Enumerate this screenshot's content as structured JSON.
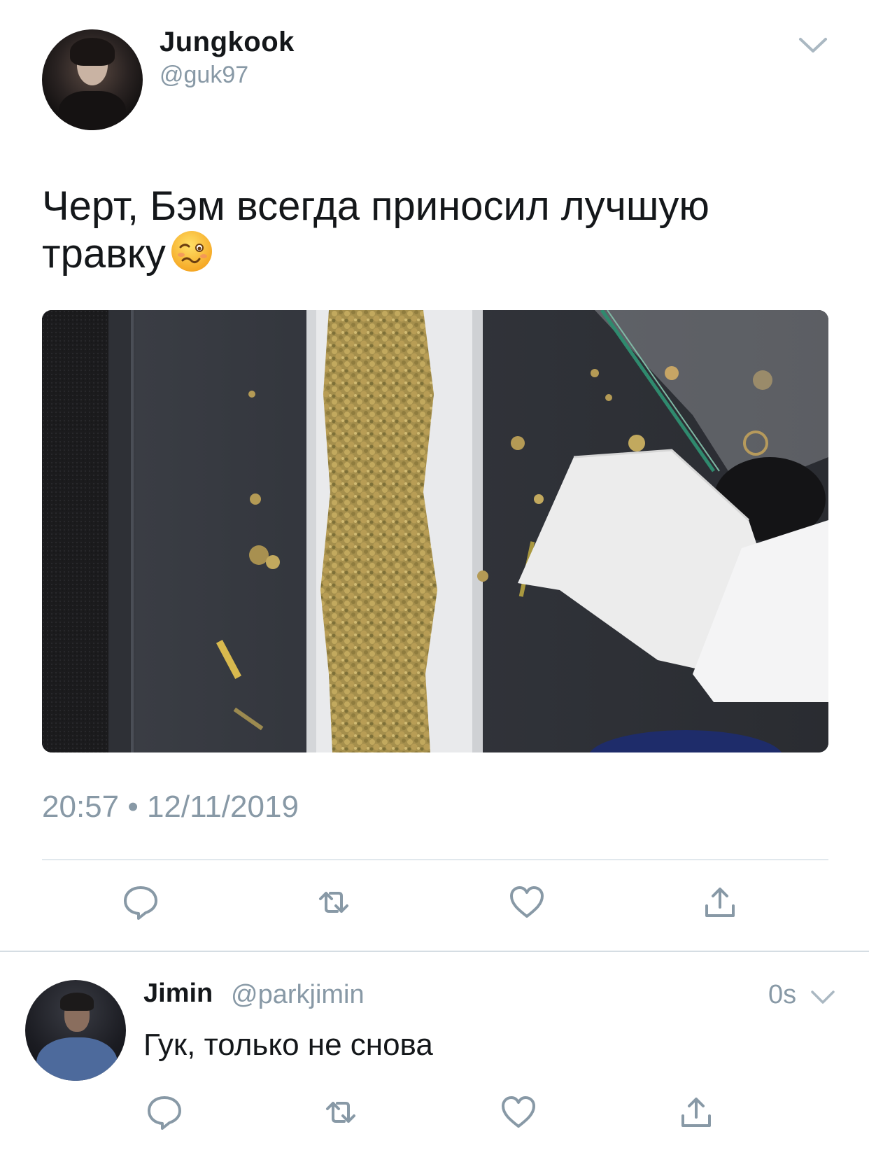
{
  "tweet": {
    "author_name": "Jungkook",
    "author_handle": "@guk97",
    "text": "Черт, Бэм всегда приносил лучшую травку",
    "emoji": "woozy-face",
    "timestamp": "20:57 • 12/11/2019",
    "actions": [
      "reply-icon",
      "retweet-icon",
      "like-icon",
      "share-icon"
    ]
  },
  "reply": {
    "author_name": "Jimin",
    "author_handle": "@parkjimin",
    "time": "0s",
    "text": "Гук, только не снова",
    "actions": [
      "reply-icon",
      "retweet-icon",
      "like-icon",
      "share-icon"
    ]
  },
  "colors": {
    "text": "#14171a",
    "secondary": "#8899a6",
    "divider": "#e1e8ed",
    "background": "#ffffff"
  }
}
